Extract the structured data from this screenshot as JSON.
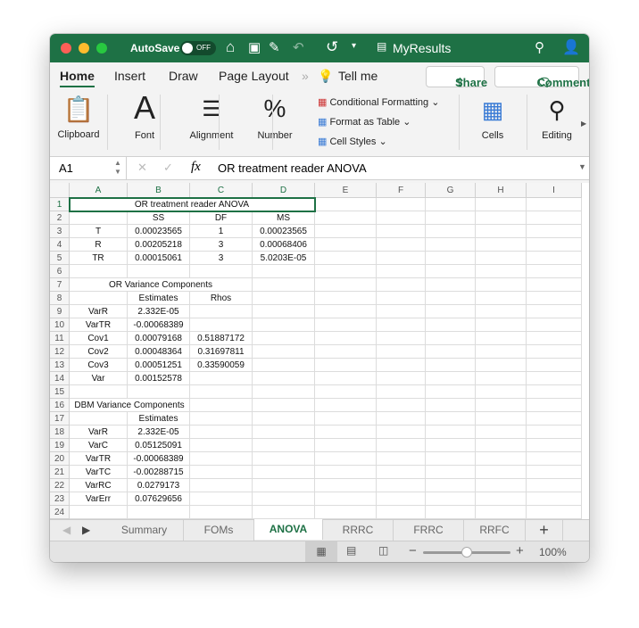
{
  "titlebar": {
    "autosave_label": "AutoSave",
    "autosave_state": "OFF",
    "filename": "MyResults"
  },
  "ribbon_tabs": [
    "Home",
    "Insert",
    "Draw",
    "Page Layout",
    "Tell me"
  ],
  "share_label": "Share",
  "comments_label": "Comments",
  "groups": {
    "clipboard": "Clipboard",
    "font": "Font",
    "alignment": "Alignment",
    "number": "Number",
    "conditional": "Conditional Formatting",
    "format_table": "Format as Table",
    "cell_styles": "Cell Styles",
    "cells": "Cells",
    "editing": "Editing"
  },
  "formula_bar": {
    "name_box": "A1",
    "formula": "OR treatment reader ANOVA"
  },
  "columns": [
    "A",
    "B",
    "C",
    "D",
    "E",
    "F",
    "G",
    "H",
    "I"
  ],
  "rows": [
    [
      "OR treatment reader ANOVA",
      "",
      "",
      ""
    ],
    [
      "",
      "SS",
      "DF",
      "MS"
    ],
    [
      "T",
      "0.00023565",
      "1",
      "0.00023565"
    ],
    [
      "R",
      "0.00205218",
      "3",
      "0.00068406"
    ],
    [
      "TR",
      "0.00015061",
      "3",
      "5.0203E-05"
    ],
    [
      "",
      "",
      "",
      ""
    ],
    [
      "OR Variance Components",
      "",
      "",
      ""
    ],
    [
      "",
      "Estimates",
      "Rhos",
      ""
    ],
    [
      "VarR",
      "2.332E-05",
      "",
      ""
    ],
    [
      "VarTR",
      "-0.00068389",
      "",
      ""
    ],
    [
      "Cov1",
      "0.00079168",
      "0.51887172",
      ""
    ],
    [
      "Cov2",
      "0.00048364",
      "0.31697811",
      ""
    ],
    [
      "Cov3",
      "0.00051251",
      "0.33590059",
      ""
    ],
    [
      "Var",
      "0.00152578",
      "",
      ""
    ],
    [
      "",
      "",
      "",
      ""
    ],
    [
      "DBM Variance Components",
      "",
      "",
      ""
    ],
    [
      "",
      "Estimates",
      "",
      ""
    ],
    [
      "VarR",
      "2.332E-05",
      "",
      ""
    ],
    [
      "VarC",
      "0.05125091",
      "",
      ""
    ],
    [
      "VarTR",
      "-0.00068389",
      "",
      ""
    ],
    [
      "VarTC",
      "-0.00288715",
      "",
      ""
    ],
    [
      "VarRC",
      "0.0279173",
      "",
      ""
    ],
    [
      "VarErr",
      "0.07629656",
      "",
      ""
    ],
    [
      "",
      "",
      "",
      ""
    ]
  ],
  "sheet_tabs": [
    "Summary",
    "FOMs",
    "ANOVA",
    "RRRC",
    "FRRC",
    "RRFC"
  ],
  "active_sheet": "ANOVA",
  "zoom": "100%",
  "zoom_level": 100,
  "accent": "#1e7145"
}
